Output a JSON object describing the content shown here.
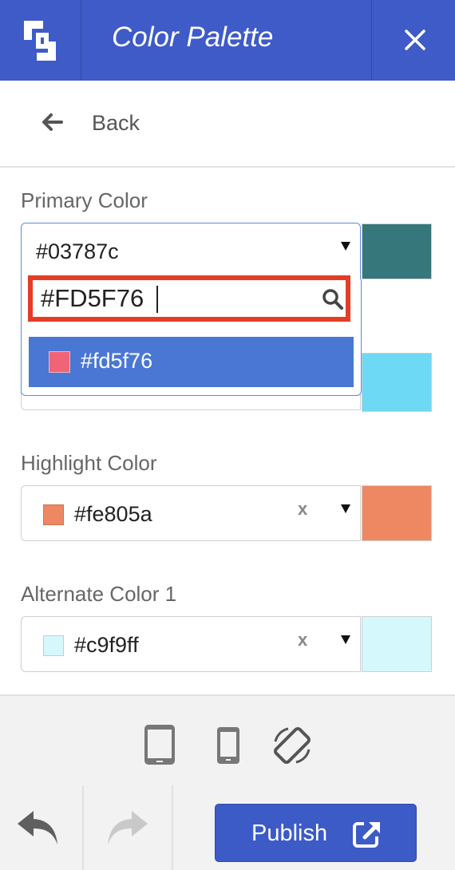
{
  "header": {
    "title": "Color Palette",
    "logo": "logo-icon",
    "close": "close-icon"
  },
  "nav": {
    "back_label": "Back",
    "back_icon": "arrow-left-icon"
  },
  "fields": {
    "primary": {
      "label": "Primary Color",
      "value": "#03787c",
      "swatch": "#35777b"
    },
    "secondary": {
      "swatch": "#6ed9f4"
    },
    "highlight": {
      "label": "Highlight Color",
      "value": "#fe805a",
      "chip": "#ee8862",
      "clear": "x",
      "swatch": "#ee8862"
    },
    "alternate1": {
      "label": "Alternate Color 1",
      "value": "#c9f9ff",
      "chip": "#d6f8fc",
      "clear": "x",
      "swatch": "#d5f8fc"
    }
  },
  "dropdown": {
    "search_value": "#FD5F76",
    "search_icon": "search-icon",
    "options": [
      {
        "label": "#fd5f76",
        "chip": "#f06478"
      }
    ]
  },
  "devices": [
    "tablet-icon",
    "phone-icon",
    "rotate-icon"
  ],
  "actions": {
    "undo_icon": "undo-icon",
    "redo_icon": "redo-icon",
    "publish_label": "Publish",
    "publish_icon": "external-link-icon"
  },
  "colors": {
    "header_bg": "#3f5bc8",
    "selected_option_bg": "#4977d3",
    "highlight_border": "#e43d26",
    "publish_bg": "#3c5bc7"
  }
}
